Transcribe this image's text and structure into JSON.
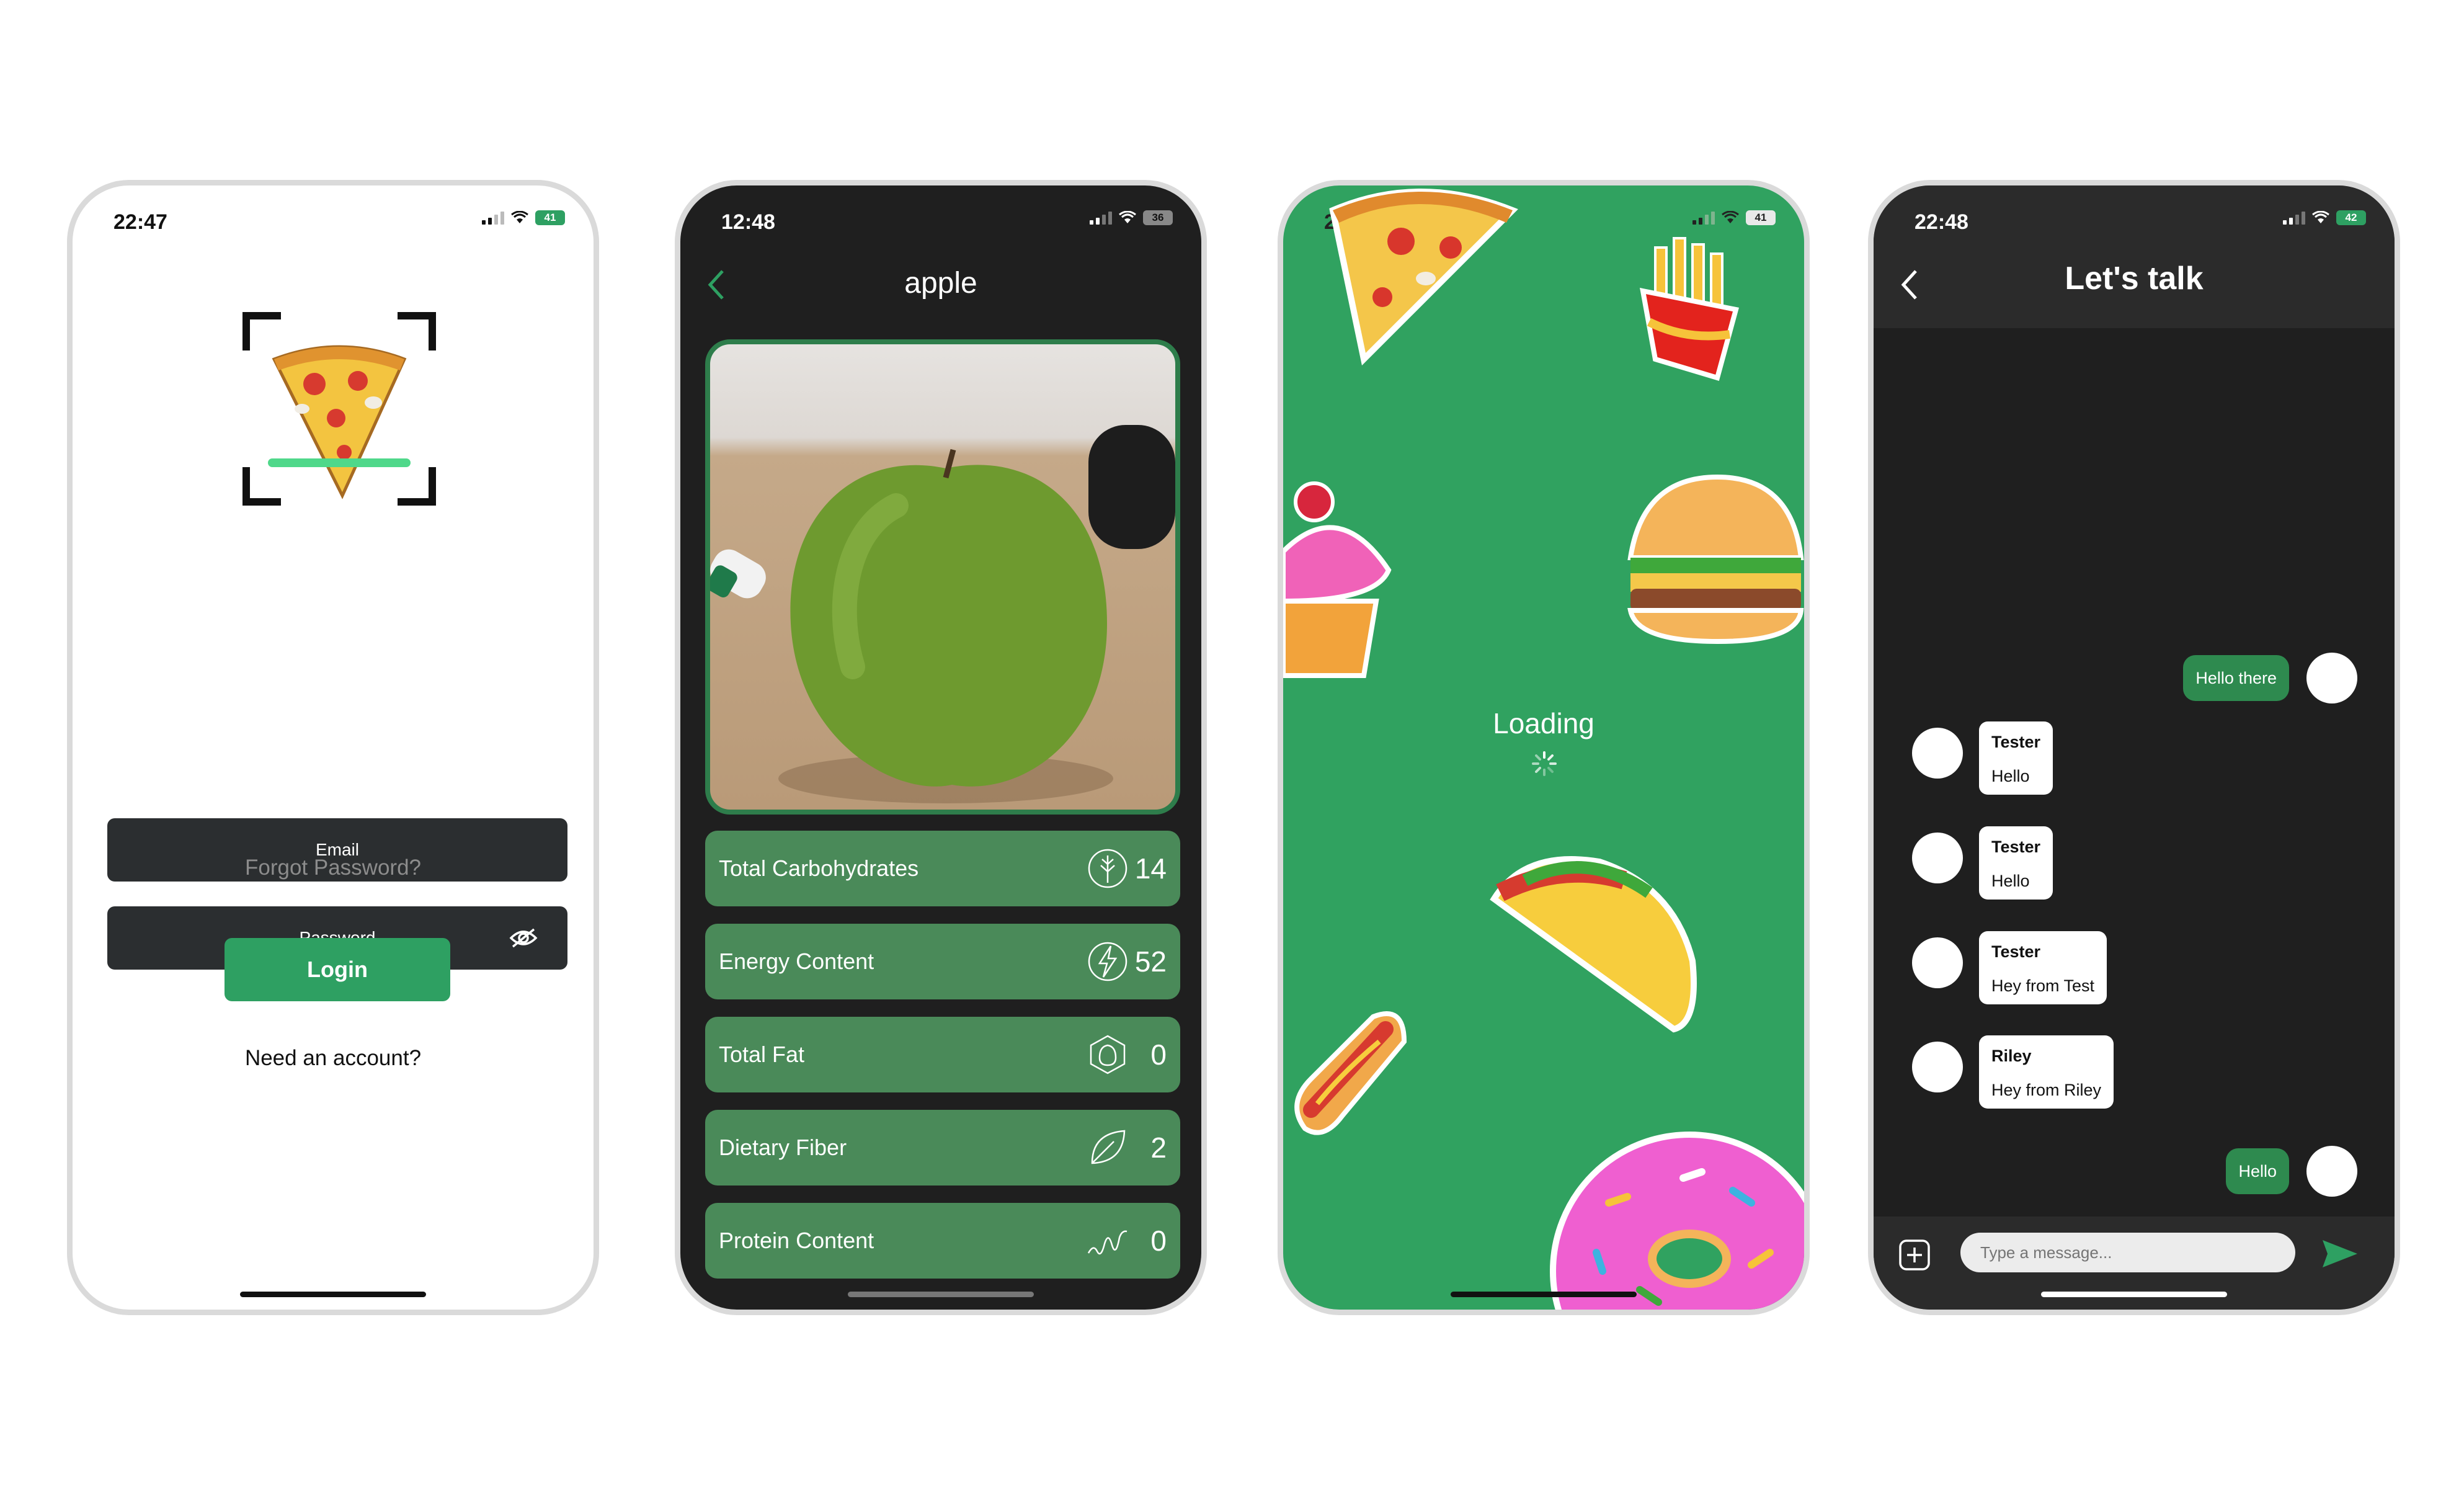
{
  "login_screen": {
    "status": {
      "time": "22:47",
      "battery": "41"
    },
    "email_label": "Email",
    "password_label": "Password",
    "forgot_password": "Forgot Password?",
    "login_button": "Login",
    "need_account": "Need an account?",
    "accent_color": "#2ea062"
  },
  "nutrition_screen": {
    "status": {
      "time": "12:48",
      "battery": "36"
    },
    "title": "apple",
    "items": [
      {
        "label": "Total Carbohydrates",
        "value": "14",
        "icon": "grain-icon"
      },
      {
        "label": "Energy Content",
        "value": "52",
        "icon": "lightning-icon"
      },
      {
        "label": "Total Fat",
        "value": "0",
        "icon": "fat-drop-icon"
      },
      {
        "label": "Dietary Fiber",
        "value": "2",
        "icon": "leaf-icon"
      },
      {
        "label": "Protein Content",
        "value": "0",
        "icon": "protein-icon"
      }
    ],
    "row_color": "#4a8a59"
  },
  "loading_screen": {
    "status": {
      "time": "22:48",
      "battery": "41"
    },
    "loading_text": "Loading",
    "background": "#30a260"
  },
  "chat_screen": {
    "status": {
      "time": "22:48",
      "battery": "42"
    },
    "title": "Let's talk",
    "messages": [
      {
        "mine": true,
        "text": "Hello there"
      },
      {
        "mine": false,
        "name": "Tester",
        "text": "Hello"
      },
      {
        "mine": false,
        "name": "Tester",
        "text": "Hello"
      },
      {
        "mine": false,
        "name": "Tester",
        "text": "Hey from Test"
      },
      {
        "mine": false,
        "name": "Riley",
        "text": "Hey from Riley"
      },
      {
        "mine": true,
        "text": "Hello"
      }
    ],
    "input_placeholder": "Type a message...",
    "accent_color": "#2e8a4f"
  }
}
